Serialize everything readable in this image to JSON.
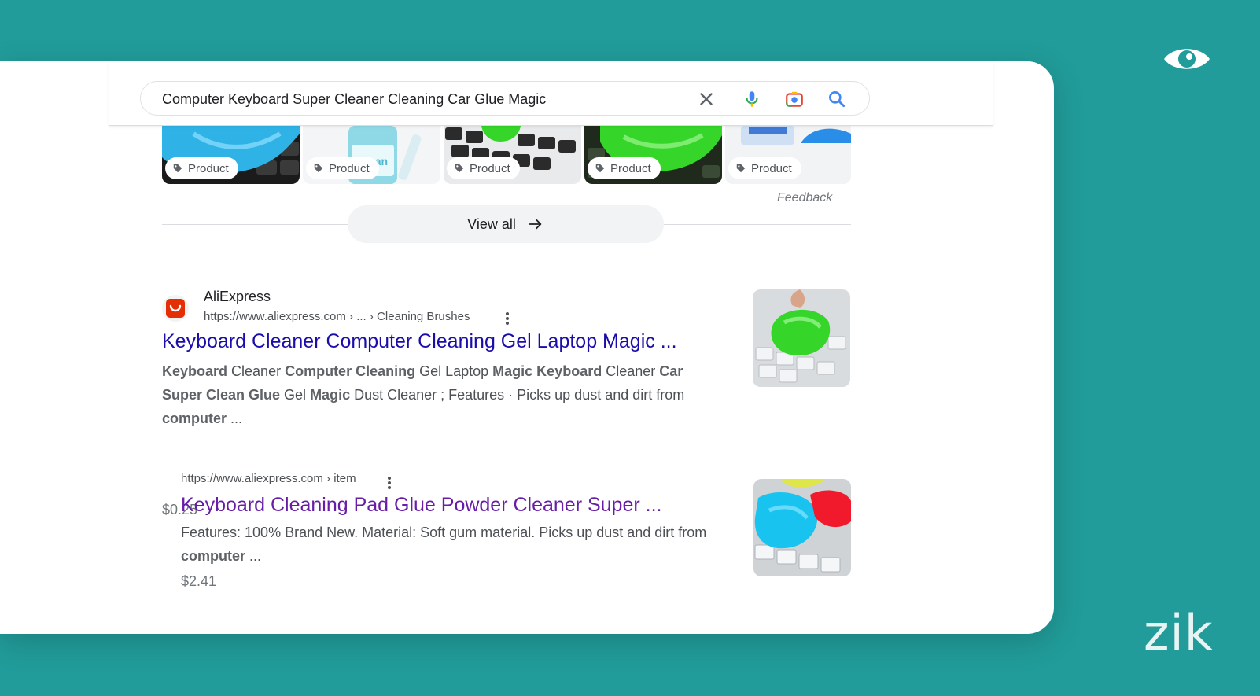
{
  "search": {
    "query": "Computer Keyboard Super Cleaner Cleaning Car Glue Magic"
  },
  "products": {
    "tags": [
      "Product",
      "Product",
      "Product",
      "Product",
      "Product"
    ],
    "feedback_label": "Feedback",
    "view_all_label": "View all"
  },
  "results": [
    {
      "site_name": "AliExpress",
      "url": "https://www.aliexpress.com › ... › Cleaning Brushes",
      "title": "Keyboard Cleaner Computer Cleaning Gel Laptop Magic ...",
      "snippet_line1_parts": [
        "Keyboard",
        " Cleaner ",
        "Computer Cleaning",
        " Gel Laptop ",
        "Magic Keyboard",
        " Cleaner ",
        "Car"
      ],
      "snippet_line2_parts": [
        "Super Clean Glue",
        " Gel ",
        "Magic",
        " Dust Cleaner ; Features · Picks up dust and dirt from"
      ],
      "snippet_line3_parts": [
        "computer",
        " ..."
      ],
      "price": "$0.25"
    },
    {
      "url": "https://www.aliexpress.com › item",
      "title": "Keyboard Cleaning Pad Glue Powder Cleaner Super ...",
      "snippet_line1": "Features: 100% Brand New. Material: Soft gum material. Picks up dust and dirt from",
      "snippet_line2_parts": [
        "computer",
        " ..."
      ],
      "price": "$2.41"
    }
  ],
  "branding": {
    "logo_text": "zik"
  },
  "colors": {
    "background": "#219c9a",
    "link": "#1a0dab",
    "visited_link": "#681da8",
    "slime_blue": "#2fb3e6",
    "slime_green": "#35d629"
  }
}
